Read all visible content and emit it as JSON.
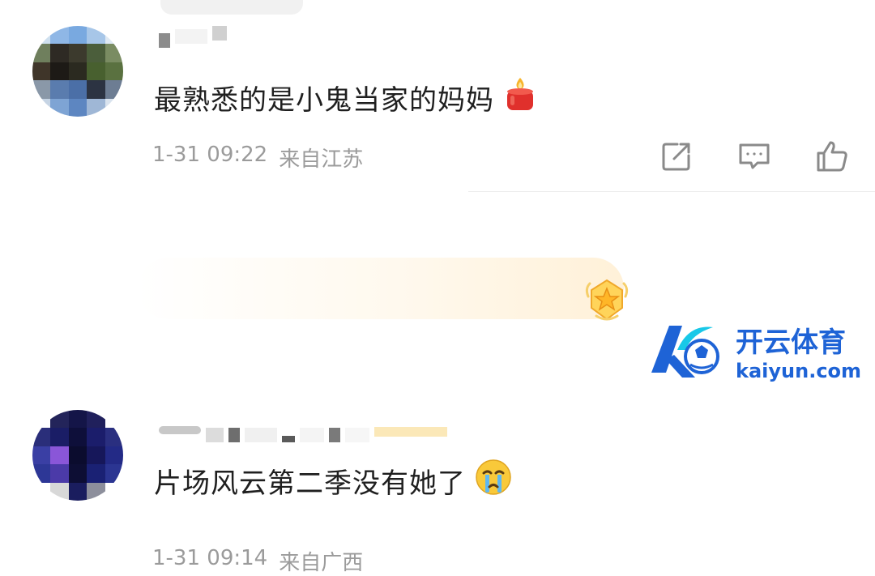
{
  "comments": [
    {
      "text": "最熟悉的是小鬼当家的妈妈",
      "emoji": "candle-emoji",
      "date": "1-31 09:22",
      "location": "来自江苏",
      "actions": [
        "share-icon",
        "comment-icon",
        "like-icon"
      ]
    },
    {
      "text": "片场风云第二季没有她了",
      "emoji": "crying-emoji",
      "date": "1-31 09:14",
      "location": "来自广西",
      "badge": "star-medal-badge"
    }
  ],
  "watermark": {
    "brand": "开云体育",
    "domain": "kaiyun.com"
  },
  "colors": {
    "meta_text": "#9b9b9b",
    "icon_stroke": "#8a8a8a",
    "brand_blue": "#1e63d6",
    "brand_cyan": "#18c8e8"
  }
}
